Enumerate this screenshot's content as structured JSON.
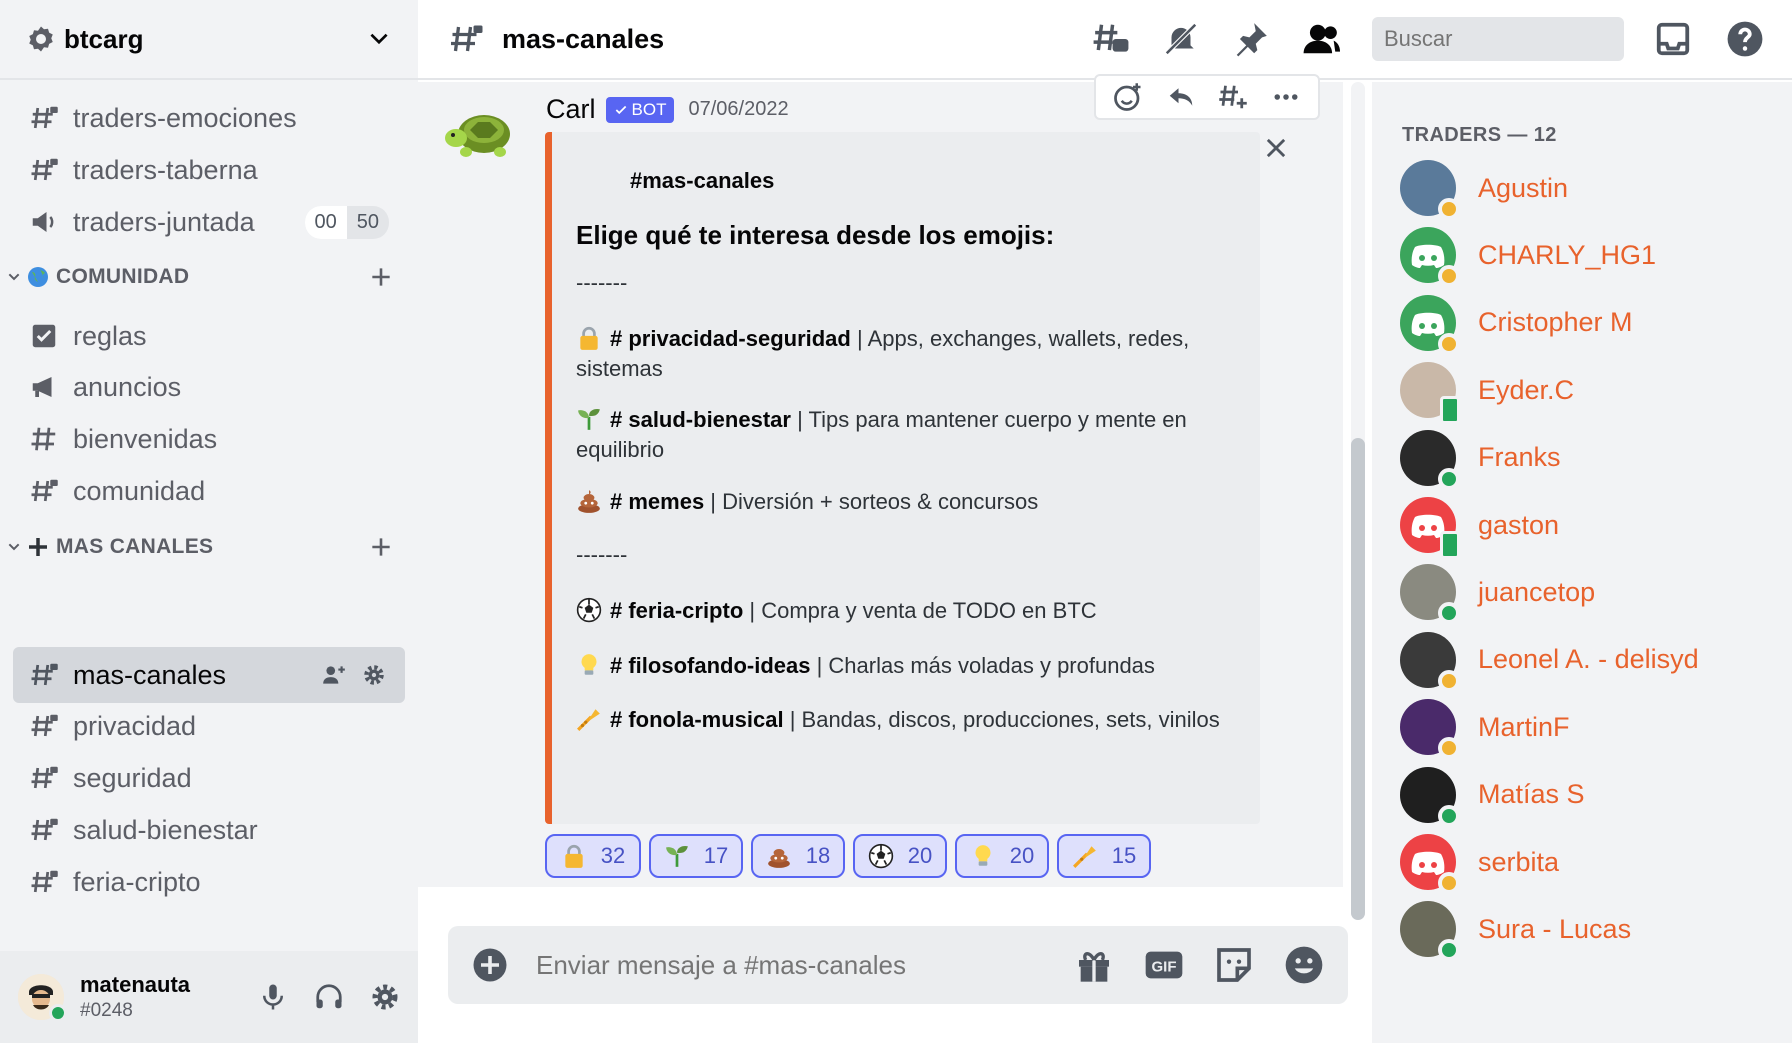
{
  "server": {
    "name": "btcarg"
  },
  "sidebar": {
    "channels_top": [
      {
        "label": "traders-emociones",
        "icon": "hash-lock-icon"
      },
      {
        "label": "traders-taberna",
        "icon": "hash-lock-icon"
      },
      {
        "label": "traders-juntada",
        "icon": "stage-icon",
        "counts": [
          "00",
          "50"
        ]
      }
    ],
    "categories": [
      {
        "label": "COMUNIDAD",
        "emoji": "globe-icon"
      },
      {
        "label": "MAS CANALES",
        "emoji": "plus-icon"
      }
    ],
    "comunidad_channels": [
      {
        "label": "reglas",
        "icon": "rules-icon"
      },
      {
        "label": "anuncios",
        "icon": "announce-icon"
      },
      {
        "label": "bienvenidas",
        "icon": "hash-icon"
      },
      {
        "label": "comunidad",
        "icon": "hash-lock-icon"
      }
    ],
    "mas_channels": [
      {
        "label": "mas-canales",
        "icon": "hash-lock-icon",
        "active": true
      },
      {
        "label": "privacidad",
        "icon": "hash-lock-icon"
      },
      {
        "label": "seguridad",
        "icon": "hash-lock-icon"
      },
      {
        "label": "salud-bienestar",
        "icon": "hash-lock-icon"
      },
      {
        "label": "feria-cripto",
        "icon": "hash-lock-icon"
      }
    ]
  },
  "user": {
    "name": "matenauta",
    "tag": "#0248"
  },
  "header": {
    "channel": "mas-canales",
    "search_placeholder": "Buscar"
  },
  "message": {
    "author": "Carl",
    "bot_label": "BOT",
    "timestamp": "07/06/2022",
    "embed": {
      "title": "#mas-canales",
      "heading": "Elige qué te interesa desde los emojis:",
      "sep1": "-------",
      "sep2": "-------",
      "items": [
        {
          "emoji": "lock",
          "channel": "# privacidad-seguridad",
          "desc": " | Apps, exchanges, wallets, redes, sistemas"
        },
        {
          "emoji": "seedling",
          "channel": "# salud-bienestar",
          "desc": " | Tips para mantener cuerpo y mente en equilibrio"
        },
        {
          "emoji": "poop",
          "channel": "# memes",
          "desc": " | Diversión + sorteos & concursos"
        },
        {
          "emoji": "soccer",
          "channel": "# feria-cripto",
          "desc": " | Compra y venta de TODO en BTC"
        },
        {
          "emoji": "bulb",
          "channel": "# filosofando-ideas",
          "desc": " | Charlas más voladas y profundas"
        },
        {
          "emoji": "trumpet",
          "channel": "# fonola-musical",
          "desc": " | Bandas, discos, producciones, sets, vinilos"
        }
      ]
    },
    "reactions": [
      {
        "emoji": "lock",
        "count": "32"
      },
      {
        "emoji": "seedling",
        "count": "17"
      },
      {
        "emoji": "poop",
        "count": "18"
      },
      {
        "emoji": "soccer",
        "count": "20"
      },
      {
        "emoji": "bulb",
        "count": "20"
      },
      {
        "emoji": "trumpet",
        "count": "15"
      }
    ]
  },
  "composer": {
    "placeholder": "Enviar mensaje a #mas-canales"
  },
  "members": {
    "header": "TRADERS — 12",
    "list": [
      {
        "name": "Agustin",
        "status": "idle",
        "avatar": "#5a7a9a"
      },
      {
        "name": "CHARLY_HG1",
        "status": "idle",
        "avatar": "#3ba55c"
      },
      {
        "name": "Cristopher M",
        "status": "idle",
        "avatar": "#3ba55c"
      },
      {
        "name": "Eyder.C",
        "status": "mobile",
        "avatar": "#c9b8a8"
      },
      {
        "name": "Franks",
        "status": "online",
        "avatar": "#2a2a2a"
      },
      {
        "name": "gaston",
        "status": "mobile",
        "avatar": "#ed4245"
      },
      {
        "name": "juancetop",
        "status": "online",
        "avatar": "#8a8a80"
      },
      {
        "name": "Leonel A. - delisyd",
        "status": "idle",
        "avatar": "#3a3a3a"
      },
      {
        "name": "MartinF",
        "status": "idle",
        "avatar": "#4a2a6a"
      },
      {
        "name": "Matías S",
        "status": "online",
        "avatar": "#1f1f1f"
      },
      {
        "name": "serbita",
        "status": "idle",
        "avatar": "#ed4245"
      },
      {
        "name": "Sura - Lucas",
        "status": "online",
        "avatar": "#6a6a5a"
      }
    ]
  }
}
